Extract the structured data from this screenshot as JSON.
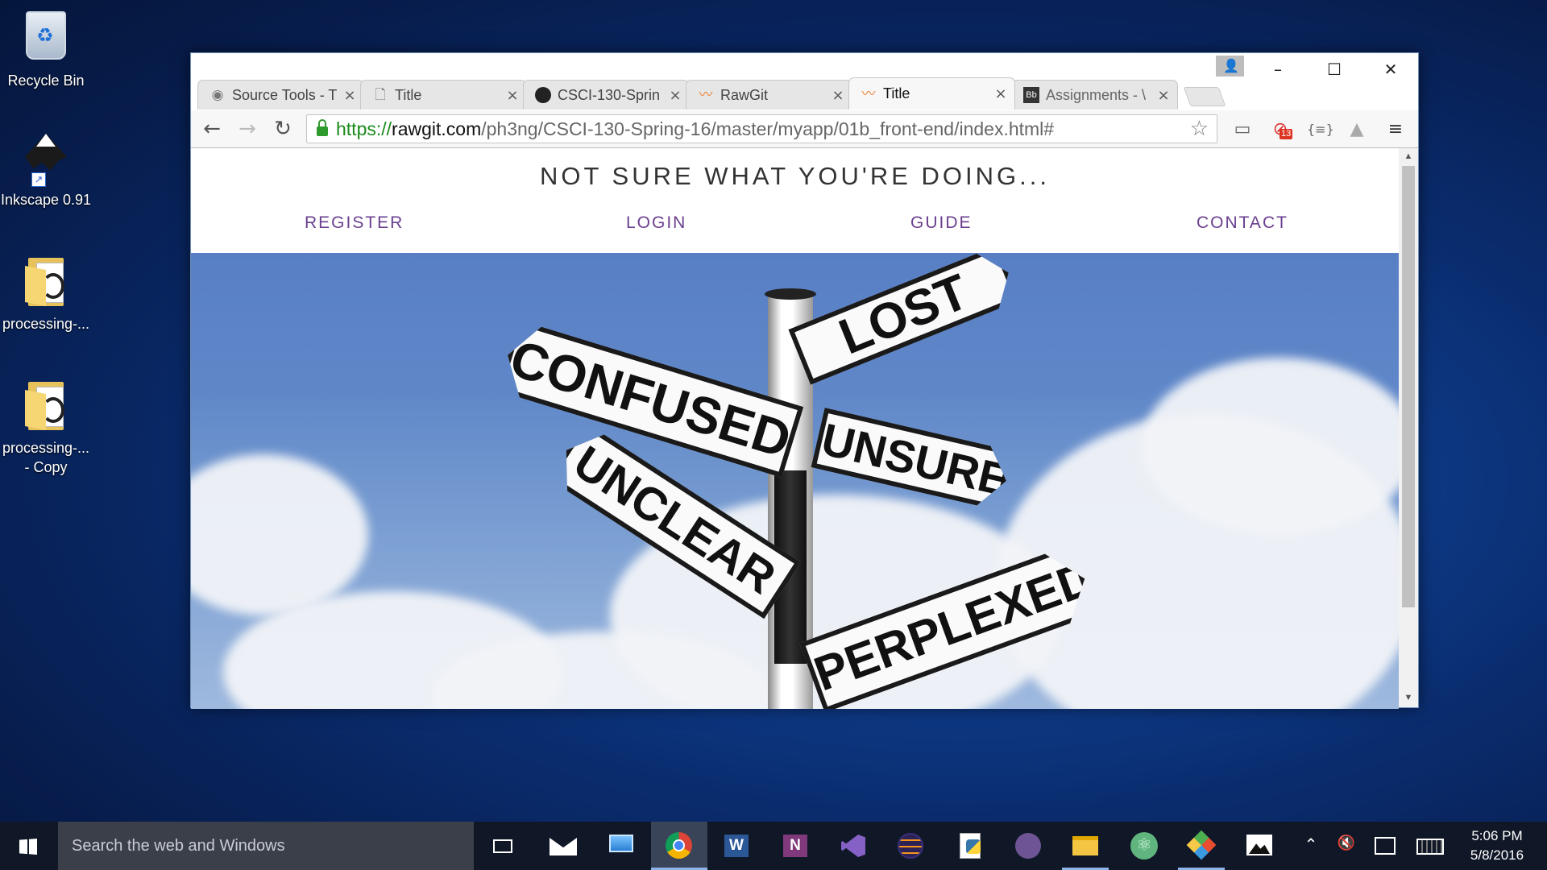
{
  "desktop": {
    "icons": [
      {
        "label": "Recycle Bin"
      },
      {
        "label": "Inkscape 0.91"
      },
      {
        "label": "processing-..."
      },
      {
        "label": "processing-...\n- Copy"
      }
    ]
  },
  "browser": {
    "tabs": [
      {
        "title": "Source Tools - T",
        "icon": "eye-icon"
      },
      {
        "title": "Title",
        "icon": "document-icon"
      },
      {
        "title": "CSCI-130-Sprin",
        "icon": "github-icon"
      },
      {
        "title": "RawGit",
        "icon": "rawgit-icon"
      },
      {
        "title": "Title",
        "icon": "rawgit-icon",
        "active": true
      },
      {
        "title": "Assignments - \\",
        "icon": "blackboard-icon"
      }
    ],
    "url": {
      "scheme": "https://",
      "host": "rawgit.com",
      "path": "/ph3ng/CSCI-130-Spring-16/master/myapp/01b_front-end/index.html#"
    },
    "extension_badge": "13"
  },
  "page": {
    "title": "NOT SURE WHAT YOU'RE DOING...",
    "nav": [
      "REGISTER",
      "LOGIN",
      "GUIDE",
      "CONTACT"
    ],
    "signs": [
      "LOST",
      "CONFUSED",
      "UNSURE",
      "UNCLEAR",
      "PERPLEXED"
    ]
  },
  "taskbar": {
    "search_placeholder": "Search the web and Windows",
    "time": "5:06 PM",
    "date": "5/8/2016",
    "apps": [
      "task-view",
      "mail",
      "remote-desktop",
      "chrome",
      "word",
      "onenote",
      "visual-studio",
      "eclipse",
      "python-files",
      "github",
      "file-explorer",
      "atom",
      "git",
      "photos"
    ]
  }
}
